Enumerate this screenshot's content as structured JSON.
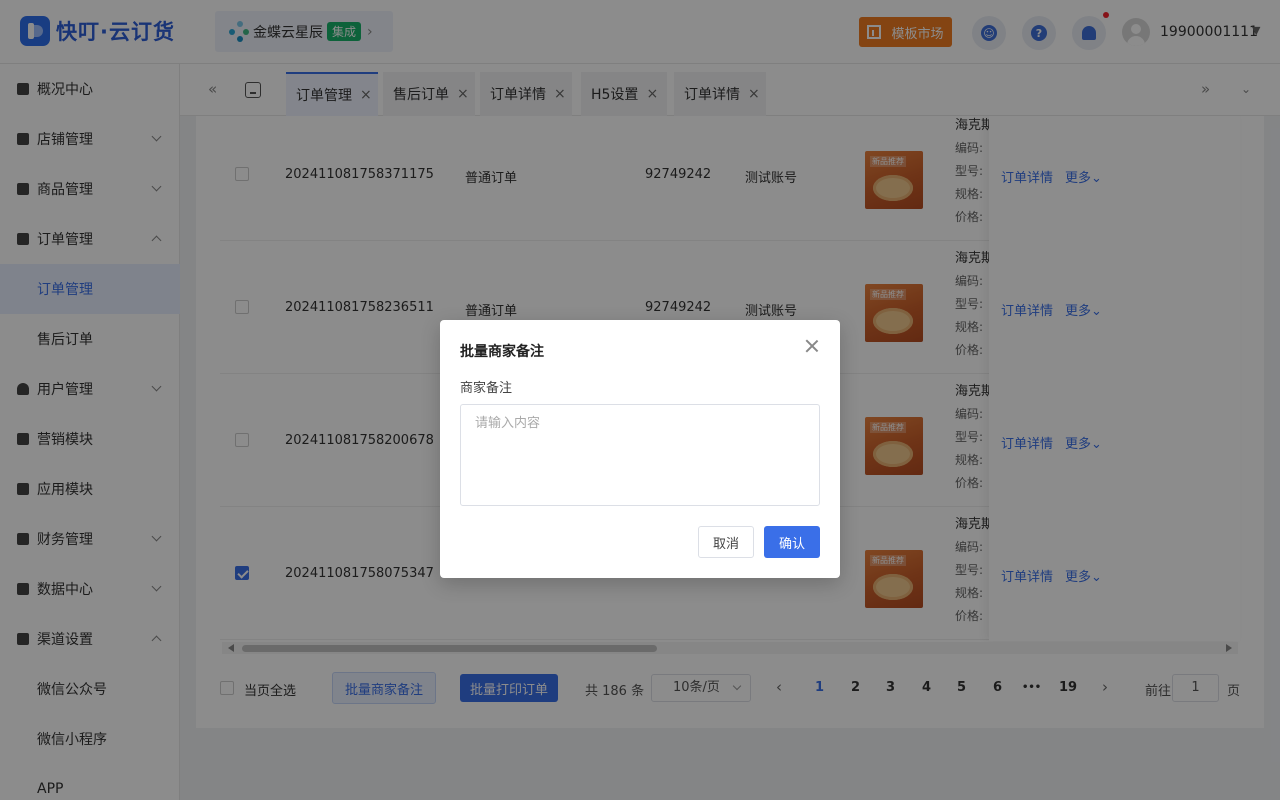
{
  "header": {
    "logo_text": "快叮·云订货",
    "kingdee": {
      "label": "金蝶云星辰",
      "badge": "集成"
    },
    "market_button": "模板市场",
    "user_phone": "19900001111"
  },
  "sidebar": {
    "items": [
      {
        "label": "概况中心",
        "icon": "lock-bag-icon"
      },
      {
        "label": "店铺管理",
        "icon": "store-icon"
      },
      {
        "label": "商品管理",
        "icon": "briefcase-icon"
      },
      {
        "label": "订单管理",
        "icon": "clipboard-icon"
      },
      {
        "label": "订单管理",
        "sub": true,
        "active": true
      },
      {
        "label": "售后订单",
        "sub": true
      },
      {
        "label": "用户管理",
        "icon": "user-icon"
      },
      {
        "label": "营销模块",
        "icon": "chart-line-icon"
      },
      {
        "label": "应用模块",
        "icon": "apps-grid-icon"
      },
      {
        "label": "财务管理",
        "icon": "wallet-icon"
      },
      {
        "label": "数据中心",
        "icon": "bar-chart-icon"
      },
      {
        "label": "渠道设置",
        "icon": "list-icon"
      },
      {
        "label": "微信公众号",
        "sub": true
      },
      {
        "label": "微信小程序",
        "sub": true
      },
      {
        "label": "APP",
        "sub": true
      }
    ]
  },
  "tabs": [
    {
      "label": "订单管理",
      "active": true
    },
    {
      "label": "售后订单"
    },
    {
      "label": "订单详情"
    },
    {
      "label": "H5设置"
    },
    {
      "label": "订单详情"
    }
  ],
  "orders": [
    {
      "order_no": "202411081758371175",
      "type": "普通订单",
      "phone": "92749242",
      "account": "测试账号",
      "checked": false
    },
    {
      "order_no": "202411081758236511",
      "type": "普通订单",
      "phone": "92749242",
      "account": "测试账号",
      "checked": false
    },
    {
      "order_no": "202411081758200678",
      "type": "",
      "phone": "",
      "account": "",
      "checked": false
    },
    {
      "order_no": "202411081758075347",
      "type": "",
      "phone": "",
      "account": "",
      "checked": true
    }
  ],
  "product": {
    "name": "海克斯",
    "code_label": "编码:",
    "model_label": "型号:",
    "spec_label": "规格:",
    "price_label": "价格:",
    "image_tag": "新品推荐"
  },
  "row_ops": {
    "detail": "订单详情",
    "more": "更多"
  },
  "footer": {
    "select_all": "当页全选",
    "batch_note": "批量商家备注",
    "batch_print": "批量打印订单",
    "total": "共 186 条",
    "page_size": "10条/页",
    "pages": [
      "1",
      "2",
      "3",
      "4",
      "5",
      "6",
      "•••",
      "19"
    ],
    "current_page": "1",
    "goto_label": "前往",
    "goto_value": "1",
    "goto_suffix": "页"
  },
  "modal": {
    "title": "批量商家备注",
    "field_label": "商家备注",
    "placeholder": "请输入内容",
    "cancel": "取消",
    "confirm": "确认"
  },
  "colors": {
    "primary": "#3a6fe8",
    "market": "#f07d21",
    "badge": "#18b26b"
  }
}
